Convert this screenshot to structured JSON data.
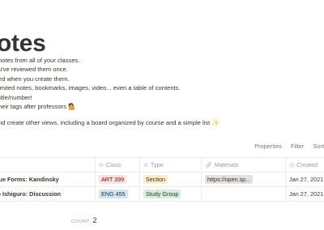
{
  "page": {
    "title": "otes",
    "description": [
      "notes from all of your classes.",
      "u've reviewed them once.",
      "ed when you create them.",
      "imited notes, bookmarks, images, video... even a table of contents.",
      "title/number!",
      "heir tags after professors 💁"
    ],
    "views_line": "nd create other views, including a board organized by course and a simple list ✨"
  },
  "toolbar": {
    "properties_label": "Properties",
    "filter_label": "Filter",
    "sort_label": "Sort"
  },
  "table": {
    "columns": {
      "name": "e",
      "class": "Class",
      "type": "Type",
      "materials": "Materials",
      "created": "Created"
    },
    "rows": [
      {
        "name": "ique Forms: Kandinsky",
        "class": "ART 399",
        "class_color": "red",
        "type": "Section",
        "type_color": "yellow",
        "materials": "https://open.sp...",
        "created": "Jan 27, 2021"
      },
      {
        "name": "uo Ishiguro: Discussion",
        "class": "ENG 455",
        "class_color": "blue",
        "type": "Study Group",
        "type_color": "green",
        "materials": "",
        "created": "Jan 27, 2021"
      }
    ]
  },
  "footer": {
    "count_label": "COUNT",
    "count_value": "2"
  }
}
